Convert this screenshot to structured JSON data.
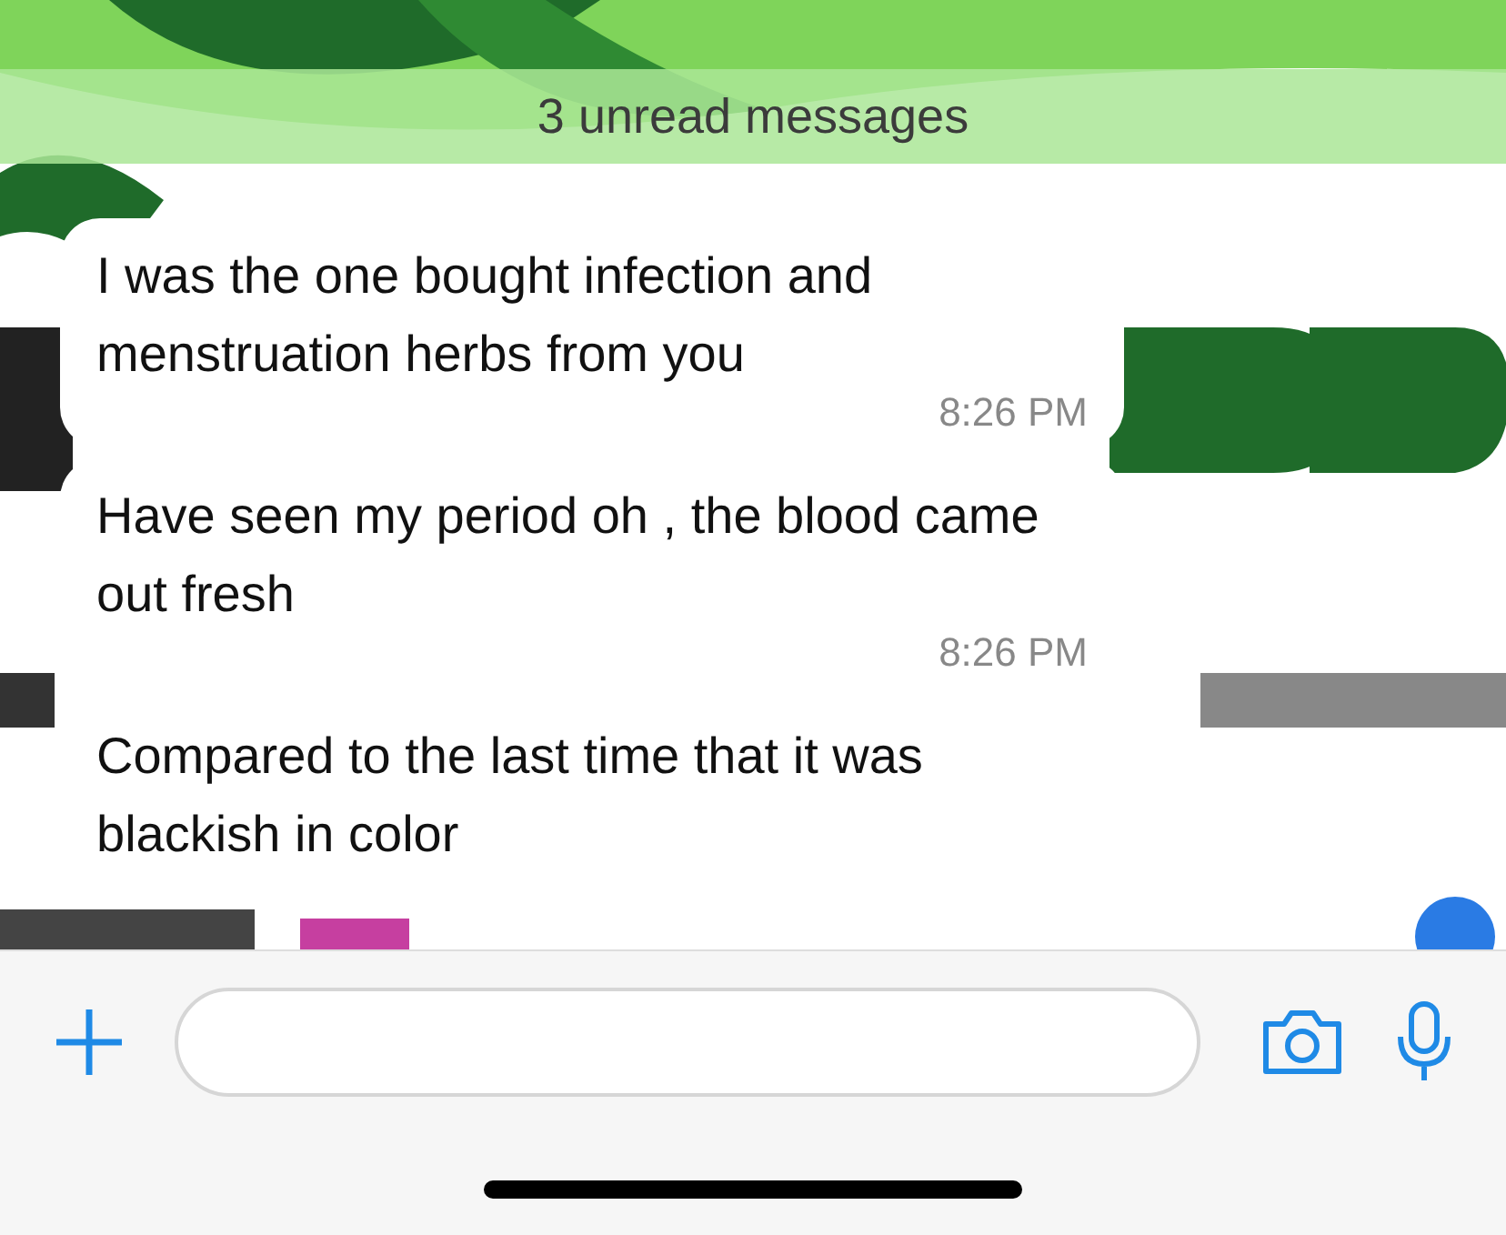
{
  "chat": {
    "unread_banner": "3 unread messages",
    "messages": [
      {
        "text": "I was the one bought infection and menstruation herbs from you",
        "time": "8:26 PM"
      },
      {
        "text": "Have seen my period oh , the blood came out fresh",
        "time": "8:26 PM"
      },
      {
        "text": "Compared to the last time that it was blackish in color"
      }
    ]
  }
}
